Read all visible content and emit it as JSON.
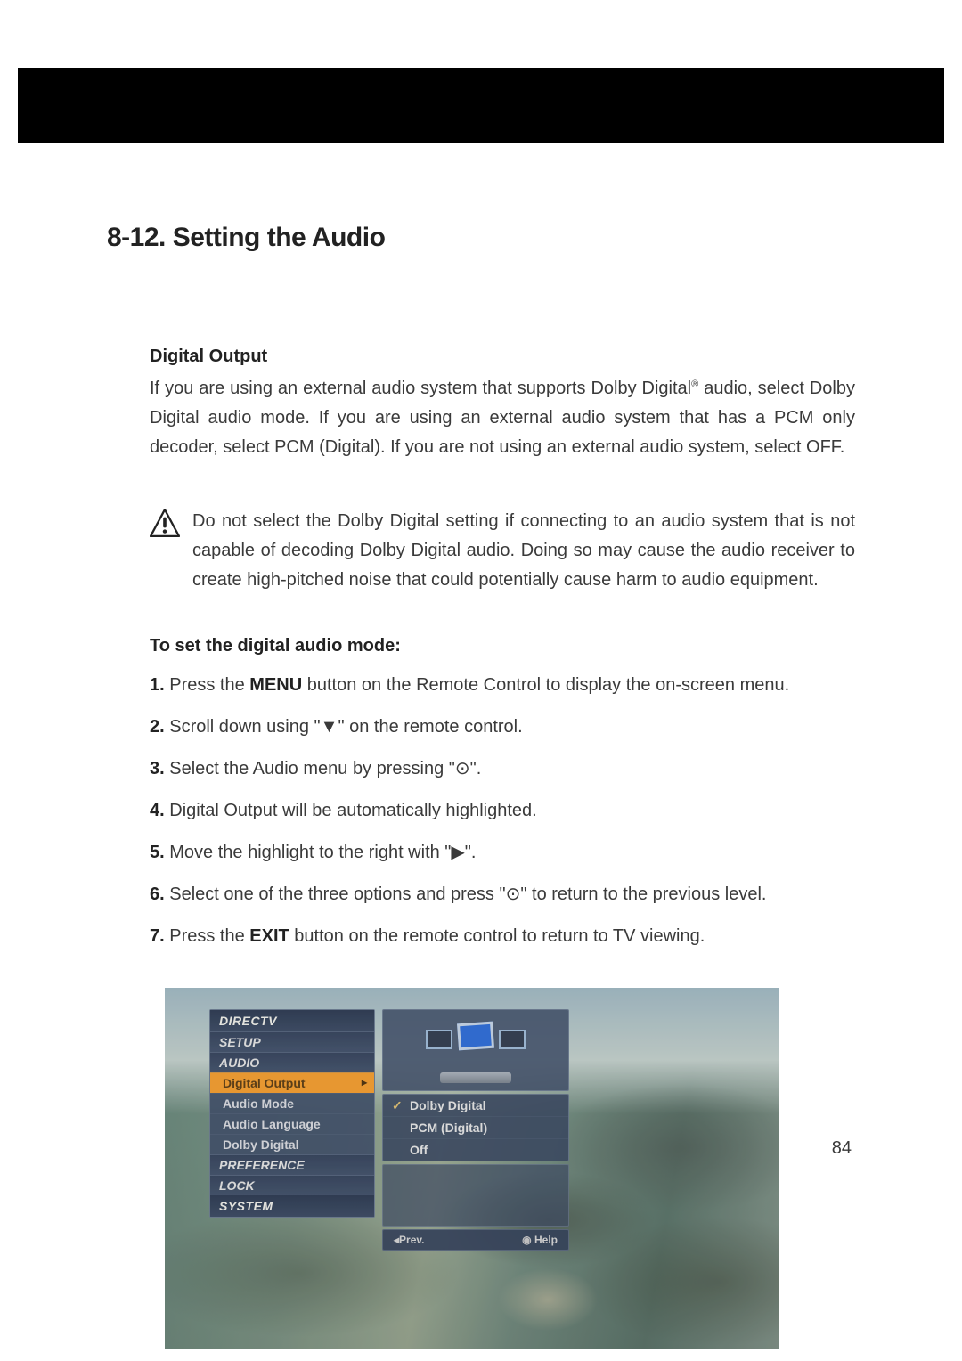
{
  "section_title": "8-12. Setting the Audio",
  "digital_output": {
    "heading": "Digital Output",
    "para_pre": "If you are using an external audio system that supports Dolby Digital",
    "para_post": " audio, select Dolby Digital audio mode.  If you are using an external audio system that has a PCM only decoder, select  PCM (Digital).  If you are not using an external audio system, select OFF."
  },
  "warning_text": "Do not select the Dolby Digital setting if connecting to an audio system that is not capable of decoding Dolby Digital audio. Doing so may cause the audio receiver to create high-pitched noise that could potentially cause harm to audio equipment.",
  "procedure_heading": "To set the digital audio mode:",
  "steps": {
    "n1": "1.",
    "s1a": " Press the ",
    "s1b": "MENU",
    "s1c": " button on the Remote Control to display the on-screen menu.",
    "n2": "2.",
    "s2a": " Scroll down using \"",
    "s2g": "▼",
    "s2b": "\" on the remote control.",
    "n3": "3.",
    "s3a": " Select the Audio menu by pressing \"",
    "s3g": "⊙",
    "s3b": "\".",
    "n4": "4.",
    "s4a": " Digital Output will be automatically highlighted.",
    "n5": "5.",
    "s5a": " Move the highlight to the right with \"",
    "s5g": "▶",
    "s5b": "\".",
    "n6": "6.",
    "s6a": " Select one of the three options and press \"",
    "s6g": "⊙",
    "s6b": "\" to return to the previous level.",
    "n7": "7.",
    "s7a": " Press the ",
    "s7b": "EXIT",
    "s7c": " button on the remote control to return to TV viewing."
  },
  "page_number": "84",
  "osd": {
    "breadcrumb": [
      "DIRECTV",
      "SETUP",
      "AUDIO"
    ],
    "left_items": [
      "Digital Output",
      "Audio Mode",
      "Audio Language",
      "Dolby Digital"
    ],
    "left_selected_index": 0,
    "left_sections": [
      "PREFERENCE",
      "LOCK",
      "SYSTEM"
    ],
    "options": [
      "Dolby Digital",
      "PCM (Digital)",
      "Off"
    ],
    "checked_index": 0,
    "footer_prev": "◂Prev.",
    "footer_help": "Help"
  }
}
